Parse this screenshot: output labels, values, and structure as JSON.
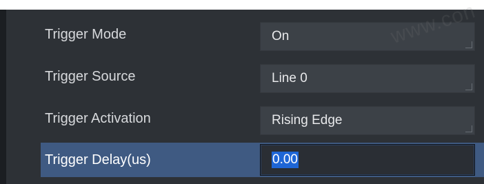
{
  "properties": [
    {
      "label": "Trigger Mode",
      "value": "On"
    },
    {
      "label": "Trigger Source",
      "value": "Line 0"
    },
    {
      "label": "Trigger Activation",
      "value": "Rising Edge"
    },
    {
      "label": "Trigger Delay(us)",
      "value": "0.00"
    }
  ],
  "watermark": "www.con",
  "colors": {
    "panel_bg": "#2d3136",
    "field_bg": "#3c4147",
    "selected_row_bg": "#3f5a82",
    "text_selection": "#1e66d6"
  }
}
